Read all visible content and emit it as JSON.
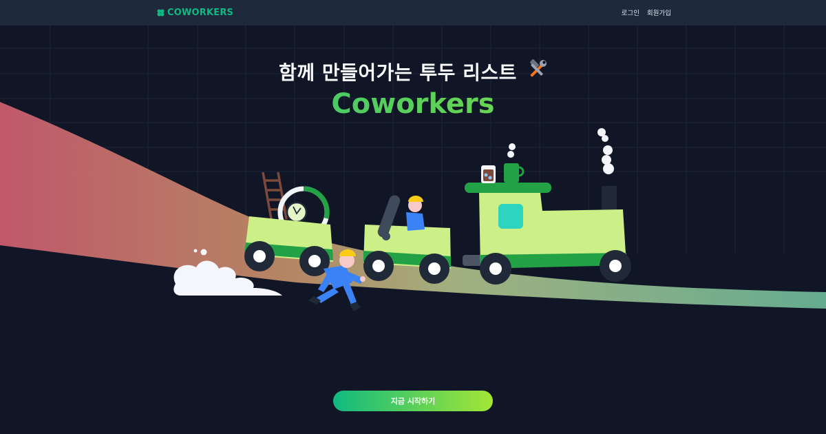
{
  "header": {
    "brand_text": "COWORKERS",
    "login_label": "로그인",
    "signup_label": "회원가입"
  },
  "hero": {
    "headline": "함께 만들어가는 투두 리스트",
    "brand_title": "Coworkers",
    "cta_label": "지금 시작하기"
  },
  "colors": {
    "background": "#101626",
    "header_bg": "#1e293b",
    "brand_green": "#10b981",
    "accent_lime": "#a3e635",
    "train_body": "#cdef88",
    "train_stripe": "#22a245"
  },
  "icons": {
    "brand_icon": "clover-icon",
    "headline_icon": "hammer-wrench-icon"
  }
}
